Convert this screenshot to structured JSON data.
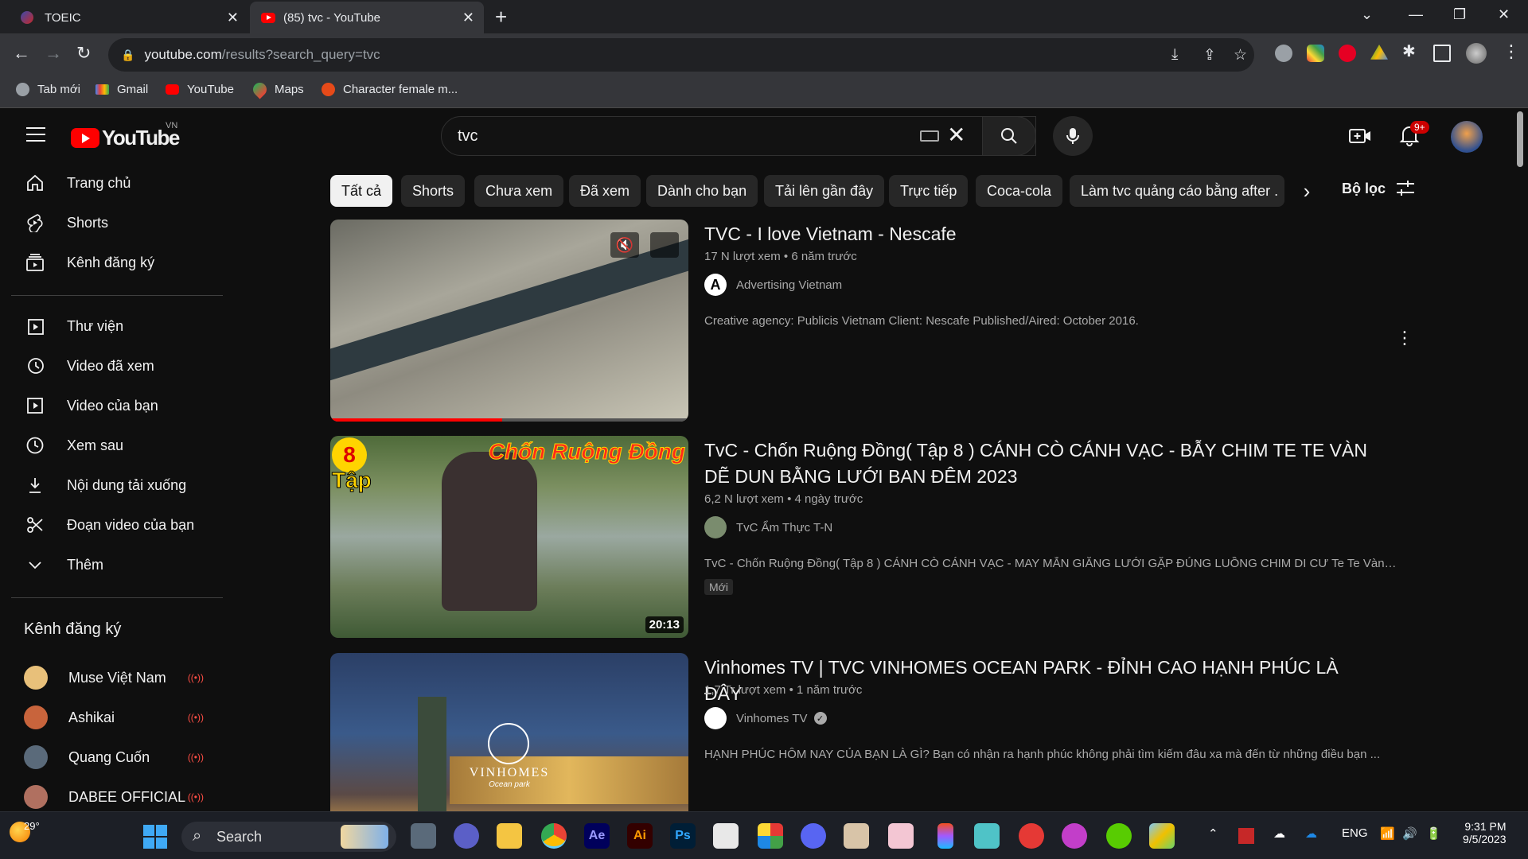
{
  "browser": {
    "tabs": [
      {
        "title": "TOEIC"
      },
      {
        "title": "(85) tvc - YouTube"
      }
    ],
    "url_host": "youtube.com",
    "url_path": "/results?search_query=tvc",
    "bookmarks": [
      {
        "label": "Tab mới",
        "icon": "globe-icon"
      },
      {
        "label": "Gmail",
        "icon": "gmail-icon"
      },
      {
        "label": "YouTube",
        "icon": "youtube-icon"
      },
      {
        "label": "Maps",
        "icon": "maps-icon"
      },
      {
        "label": "Character female m...",
        "icon": "character-icon"
      }
    ]
  },
  "youtube": {
    "logo_text": "YouTube",
    "region": "VN",
    "search_query": "tvc",
    "notif_count": "9+",
    "sidebar": {
      "main": [
        {
          "label": "Trang chủ",
          "icon": "home-icon"
        },
        {
          "label": "Shorts",
          "icon": "shorts-icon"
        },
        {
          "label": "Kênh đăng ký",
          "icon": "subscriptions-icon"
        }
      ],
      "library": [
        {
          "label": "Thư viện",
          "icon": "library-icon"
        },
        {
          "label": "Video đã xem",
          "icon": "history-icon"
        },
        {
          "label": "Video của bạn",
          "icon": "your-videos-icon"
        },
        {
          "label": "Xem sau",
          "icon": "watch-later-icon"
        },
        {
          "label": "Nội dung tải xuống",
          "icon": "download-icon"
        },
        {
          "label": "Đoạn video của bạn",
          "icon": "clips-icon"
        },
        {
          "label": "Thêm",
          "icon": "chevron-down-icon"
        }
      ],
      "subs_heading": "Kênh đăng ký",
      "subscriptions": [
        {
          "label": "Muse Việt Nam",
          "color": "#e8c07a"
        },
        {
          "label": "Ashikai",
          "color": "#c8643c"
        },
        {
          "label": "Quang Cuốn",
          "color": "#5a6a7a"
        },
        {
          "label": "DABEE OFFICIAL",
          "color": "#b07060"
        }
      ]
    },
    "chips": [
      "Tất cả",
      "Shorts",
      "Chưa xem",
      "Đã xem",
      "Dành cho bạn",
      "Tải lên gần đây",
      "Trực tiếp",
      "Coca-cola",
      "Làm tvc quảng cáo bằng after ."
    ],
    "filter_label": "Bộ lọc",
    "results": [
      {
        "title": "TVC - I love Vietnam - Nescafe",
        "meta": "17 N lượt xem • 6 năm trước",
        "channel": "Advertising Vietnam",
        "description": "Creative agency: Publicis Vietnam Client: Nescafe Published/Aired: October 2016.",
        "progress": 0.48
      },
      {
        "title": "TvC - Chốn Ruộng Đồng( Tập 8 ) CÁNH CÒ CÁNH VẠC - BẪY CHIM TE TE VÀN DẼ DUN BẰNG LƯỚI BAN ĐÊM 2023",
        "meta": "6,2 N lượt xem • 4 ngày trước",
        "channel": "TvC Ẩm Thực T-N",
        "description": "TvC - Chốn Ruộng Đồng( Tập 8 ) CÁNH CÒ CÁNH VẠC - MAY MẮN GIĂNG LƯỚI GẶP ĐÚNG LUỒNG CHIM DI CƯ Te Te Vàng ...",
        "badge": "Mới",
        "duration": "20:13",
        "thumb_number": "8",
        "thumb_tap": "Tập",
        "thumb_caption": "Chốn Ruộng Đồng"
      },
      {
        "title": "Vinhomes TV | TVC VINHOMES OCEAN PARK - ĐỈNH CAO HẠNH PHÚC LÀ ĐÂY",
        "meta": "1,7 Tr lượt xem • 1 năm trước",
        "channel": "Vinhomes TV",
        "description": "HẠNH PHÚC HÔM NAY CỦA BẠN LÀ GÌ? Bạn có nhận ra hạnh phúc không phải tìm kiếm đâu xa mà đến từ những điều bạn ...",
        "thumb_brand": "VINHOMES",
        "thumb_sub": "Ocean park"
      }
    ]
  },
  "taskbar": {
    "weather": "29°",
    "search_label": "Search",
    "lang": "ENG",
    "time": "9:31 PM",
    "date": "9/5/2023",
    "apps": [
      "file-explorer-icon",
      "meet-icon",
      "folder-icon",
      "chrome-icon",
      "after-effects-icon",
      "illustrator-icon",
      "photoshop-icon",
      "store-icon",
      "office-icon",
      "discord-icon",
      "app-icon",
      "anime-icon",
      "figma-icon",
      "m-app-icon",
      "s-app-icon",
      "w-app-icon",
      "duolingo-icon",
      "cube-icon"
    ],
    "app_labels": {
      "ae": "Ae",
      "ai": "Ai",
      "ps": "Ps"
    }
  }
}
